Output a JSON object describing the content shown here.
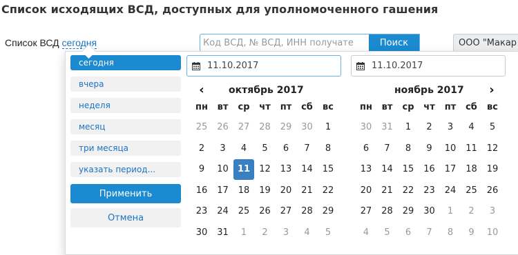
{
  "page": {
    "title": "Список исходящих ВСД, доступных для уполномоченного гашения"
  },
  "filter": {
    "label": "Список ВСД",
    "period_link": "сегодня"
  },
  "search": {
    "placeholder": "Код ВСД, № ВСД, ИНН получате",
    "button_label": "Поиск"
  },
  "organization_select": {
    "value": "ООО \"Макар"
  },
  "date_picker": {
    "ranges": [
      {
        "label": "сегодня",
        "active": true
      },
      {
        "label": "вчера",
        "active": false
      },
      {
        "label": "неделя",
        "active": false
      },
      {
        "label": "месяц",
        "active": false
      },
      {
        "label": "три месяца",
        "active": false
      },
      {
        "label": "указать период...",
        "active": false
      }
    ],
    "apply_label": "Применить",
    "cancel_label": "Отмена",
    "start_date": "11.10.2017",
    "end_date": "11.10.2017",
    "weekdays": [
      "пн",
      "вт",
      "ср",
      "чт",
      "пт",
      "сб",
      "вс"
    ],
    "left_calendar": {
      "month_label": "октябрь 2017",
      "weeks": [
        [
          [
            "25",
            "off"
          ],
          [
            "26",
            "off"
          ],
          [
            "27",
            "off"
          ],
          [
            "28",
            "off"
          ],
          [
            "29",
            "off"
          ],
          [
            "30",
            "off"
          ],
          [
            "1",
            "on"
          ]
        ],
        [
          [
            "2",
            "on"
          ],
          [
            "3",
            "on"
          ],
          [
            "4",
            "on"
          ],
          [
            "5",
            "on"
          ],
          [
            "6",
            "on"
          ],
          [
            "7",
            "on"
          ],
          [
            "8",
            "on"
          ]
        ],
        [
          [
            "9",
            "on"
          ],
          [
            "10",
            "on"
          ],
          [
            "11",
            "selected"
          ],
          [
            "12",
            "on"
          ],
          [
            "13",
            "on"
          ],
          [
            "14",
            "on"
          ],
          [
            "15",
            "on"
          ]
        ],
        [
          [
            "16",
            "on"
          ],
          [
            "17",
            "on"
          ],
          [
            "18",
            "on"
          ],
          [
            "19",
            "on"
          ],
          [
            "20",
            "on"
          ],
          [
            "21",
            "on"
          ],
          [
            "22",
            "on"
          ]
        ],
        [
          [
            "23",
            "on"
          ],
          [
            "24",
            "on"
          ],
          [
            "25",
            "on"
          ],
          [
            "26",
            "on"
          ],
          [
            "27",
            "on"
          ],
          [
            "28",
            "on"
          ],
          [
            "29",
            "on"
          ]
        ],
        [
          [
            "30",
            "on"
          ],
          [
            "31",
            "on"
          ],
          [
            "1",
            "off"
          ],
          [
            "2",
            "off"
          ],
          [
            "3",
            "off"
          ],
          [
            "4",
            "off"
          ],
          [
            "5",
            "off"
          ]
        ]
      ]
    },
    "right_calendar": {
      "month_label": "ноябрь 2017",
      "weeks": [
        [
          [
            "30",
            "off"
          ],
          [
            "31",
            "off"
          ],
          [
            "1",
            "on"
          ],
          [
            "2",
            "on"
          ],
          [
            "3",
            "on"
          ],
          [
            "4",
            "on"
          ],
          [
            "5",
            "on"
          ]
        ],
        [
          [
            "6",
            "on"
          ],
          [
            "7",
            "on"
          ],
          [
            "8",
            "on"
          ],
          [
            "9",
            "on"
          ],
          [
            "10",
            "on"
          ],
          [
            "11",
            "on"
          ],
          [
            "12",
            "on"
          ]
        ],
        [
          [
            "13",
            "on"
          ],
          [
            "14",
            "on"
          ],
          [
            "15",
            "on"
          ],
          [
            "16",
            "on"
          ],
          [
            "17",
            "on"
          ],
          [
            "18",
            "on"
          ],
          [
            "19",
            "on"
          ]
        ],
        [
          [
            "20",
            "on"
          ],
          [
            "21",
            "on"
          ],
          [
            "22",
            "on"
          ],
          [
            "23",
            "on"
          ],
          [
            "24",
            "on"
          ],
          [
            "25",
            "on"
          ],
          [
            "26",
            "on"
          ]
        ],
        [
          [
            "27",
            "on"
          ],
          [
            "28",
            "on"
          ],
          [
            "29",
            "on"
          ],
          [
            "30",
            "on"
          ],
          [
            "1",
            "off"
          ],
          [
            "2",
            "off"
          ],
          [
            "3",
            "off"
          ]
        ],
        [
          [
            "4",
            "off"
          ],
          [
            "5",
            "off"
          ],
          [
            "6",
            "off"
          ],
          [
            "7",
            "off"
          ],
          [
            "8",
            "off"
          ],
          [
            "9",
            "off"
          ],
          [
            "10",
            "off"
          ]
        ]
      ]
    }
  },
  "colors": {
    "accent": "#1b8ad0",
    "selected_day": "#3a7fc2",
    "link": "#1a73c2",
    "muted_day": "#999999"
  }
}
